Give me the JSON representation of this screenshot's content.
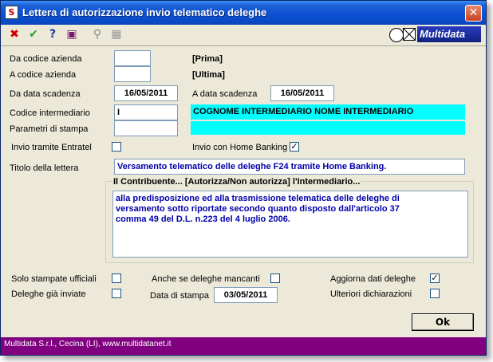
{
  "window": {
    "title": "Lettera di autorizzazione invio telematico deleghe",
    "close_glyph": "✕"
  },
  "toolbar": {
    "items": [
      {
        "icon": "cancel-icon",
        "glyph": "✖",
        "color": "#cc0000"
      },
      {
        "icon": "confirm-icon",
        "glyph": "✔",
        "color": "#2a9a2a"
      },
      {
        "icon": "help-icon",
        "glyph": "?",
        "color": "#1a3a9a"
      },
      {
        "icon": "book-icon",
        "glyph": "▣",
        "color": "#7a1a6a"
      },
      {
        "icon": "binoculars-icon",
        "glyph": "⚲",
        "color": "#888888"
      },
      {
        "icon": "calculator-icon",
        "glyph": "▦",
        "color": "#999999"
      }
    ],
    "logo_text": "Multidata"
  },
  "form": {
    "da_codice_azienda_label": "Da codice azienda",
    "da_codice_azienda_value": "",
    "prima_label": "[Prima]",
    "a_codice_azienda_label": "A codice azienda",
    "a_codice_azienda_value": "",
    "ultima_label": "[Ultima]",
    "da_data_scadenza_label": "Da data scadenza",
    "da_data_scadenza_value": "16/05/2011",
    "a_data_scadenza_label": "A data scadenza",
    "a_data_scadenza_value": "16/05/2011",
    "codice_intermediario_label": "Codice intermediario",
    "codice_intermediario_value": "I",
    "intermediario_nome_value": "COGNOME INTERMEDIARIO NOME INTERMEDIARIO",
    "parametri_stampa_label": "Parametri di stampa",
    "parametri_stampa_value": "",
    "parametri_descr_value": "",
    "invio_entratel_label": "Invio tramite Entratel",
    "invio_entratel_checked": false,
    "invio_home_banking_label": "Invio con Home Banking",
    "invio_home_banking_checked": true,
    "titolo_lettera_label": "Titolo della lettera",
    "titolo_lettera_value": "Versamento telematico delle deleghe F24 tramite Home Banking.",
    "group_legend": "Il Contribuente... [Autorizza/Non autorizza] l'Intermediario...",
    "testo_lines": [
      "alla predisposizione ed alla trasmissione telematica delle deleghe di",
      "versamento  sotto riportate secondo quanto disposto  dall'articolo 37",
      "comma 49 del D.L. n.223 del 4 luglio 2006."
    ],
    "solo_stampate_label": "Solo stampate ufficiali",
    "solo_stampate_checked": false,
    "anche_mancanti_label": "Anche se deleghe mancanti",
    "anche_mancanti_checked": false,
    "aggiorna_dati_label": "Aggiorna dati deleghe",
    "aggiorna_dati_checked": true,
    "deleghe_inviate_label": "Deleghe già inviate",
    "deleghe_inviate_checked": false,
    "data_stampa_label": "Data di stampa",
    "data_stampa_value": "03/05/2011",
    "ulteriori_label": "Ulteriori dichiarazioni",
    "ulteriori_checked": false,
    "ok_label": "Ok"
  },
  "status": {
    "text": "Multidata S.r.l., Cecina (LI), www.multidatanet.it"
  },
  "colors": {
    "titlebar": "#0b4fd1",
    "highlight_field": "#00ffff",
    "statusbar": "#800080",
    "text_blue": "#0000aa"
  }
}
